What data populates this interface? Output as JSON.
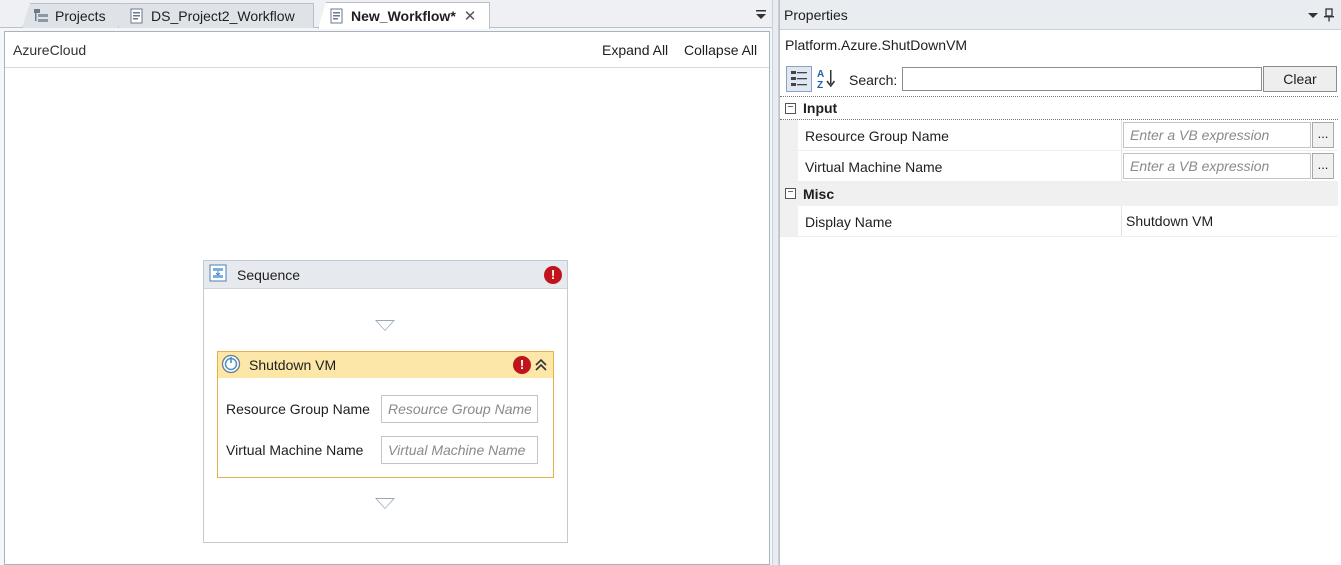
{
  "tabs": [
    {
      "label": "Projects",
      "icon": "project-tree-icon"
    },
    {
      "label": "DS_Project2_Workflow",
      "icon": "workflow-doc-icon"
    },
    {
      "label": "New_Workflow*",
      "icon": "workflow-doc-icon",
      "active": true
    }
  ],
  "designer": {
    "breadcrumb": "AzureCloud",
    "expand_all": "Expand All",
    "collapse_all": "Collapse All",
    "sequence": {
      "title": "Sequence",
      "activity": {
        "title": "Shutdown VM",
        "fields": [
          {
            "label": "Resource Group Name",
            "placeholder": "Resource Group Name"
          },
          {
            "label": "Virtual Machine Name",
            "placeholder": "Virtual Machine Name"
          }
        ]
      }
    }
  },
  "properties": {
    "title": "Properties",
    "type_name": "Platform.Azure.ShutDownVM",
    "search_label": "Search:",
    "search_value": "",
    "clear_label": "Clear",
    "categories": [
      {
        "name": "Input",
        "collapse_glyph": "−",
        "props": [
          {
            "name": "Resource Group Name",
            "placeholder": "Enter a VB expression",
            "button": "..."
          },
          {
            "name": "Virtual Machine Name",
            "placeholder": "Enter a VB expression",
            "button": "..."
          }
        ]
      },
      {
        "name": "Misc",
        "collapse_glyph": "−",
        "props": [
          {
            "name": "Display Name",
            "value": "Shutdown VM"
          }
        ]
      }
    ]
  },
  "colors": {
    "error": "#c0141c",
    "activity_header": "#fce7a8",
    "activity_border": "#e3b34a",
    "sequence_header": "#e6e9ed"
  },
  "error_glyph": "!"
}
